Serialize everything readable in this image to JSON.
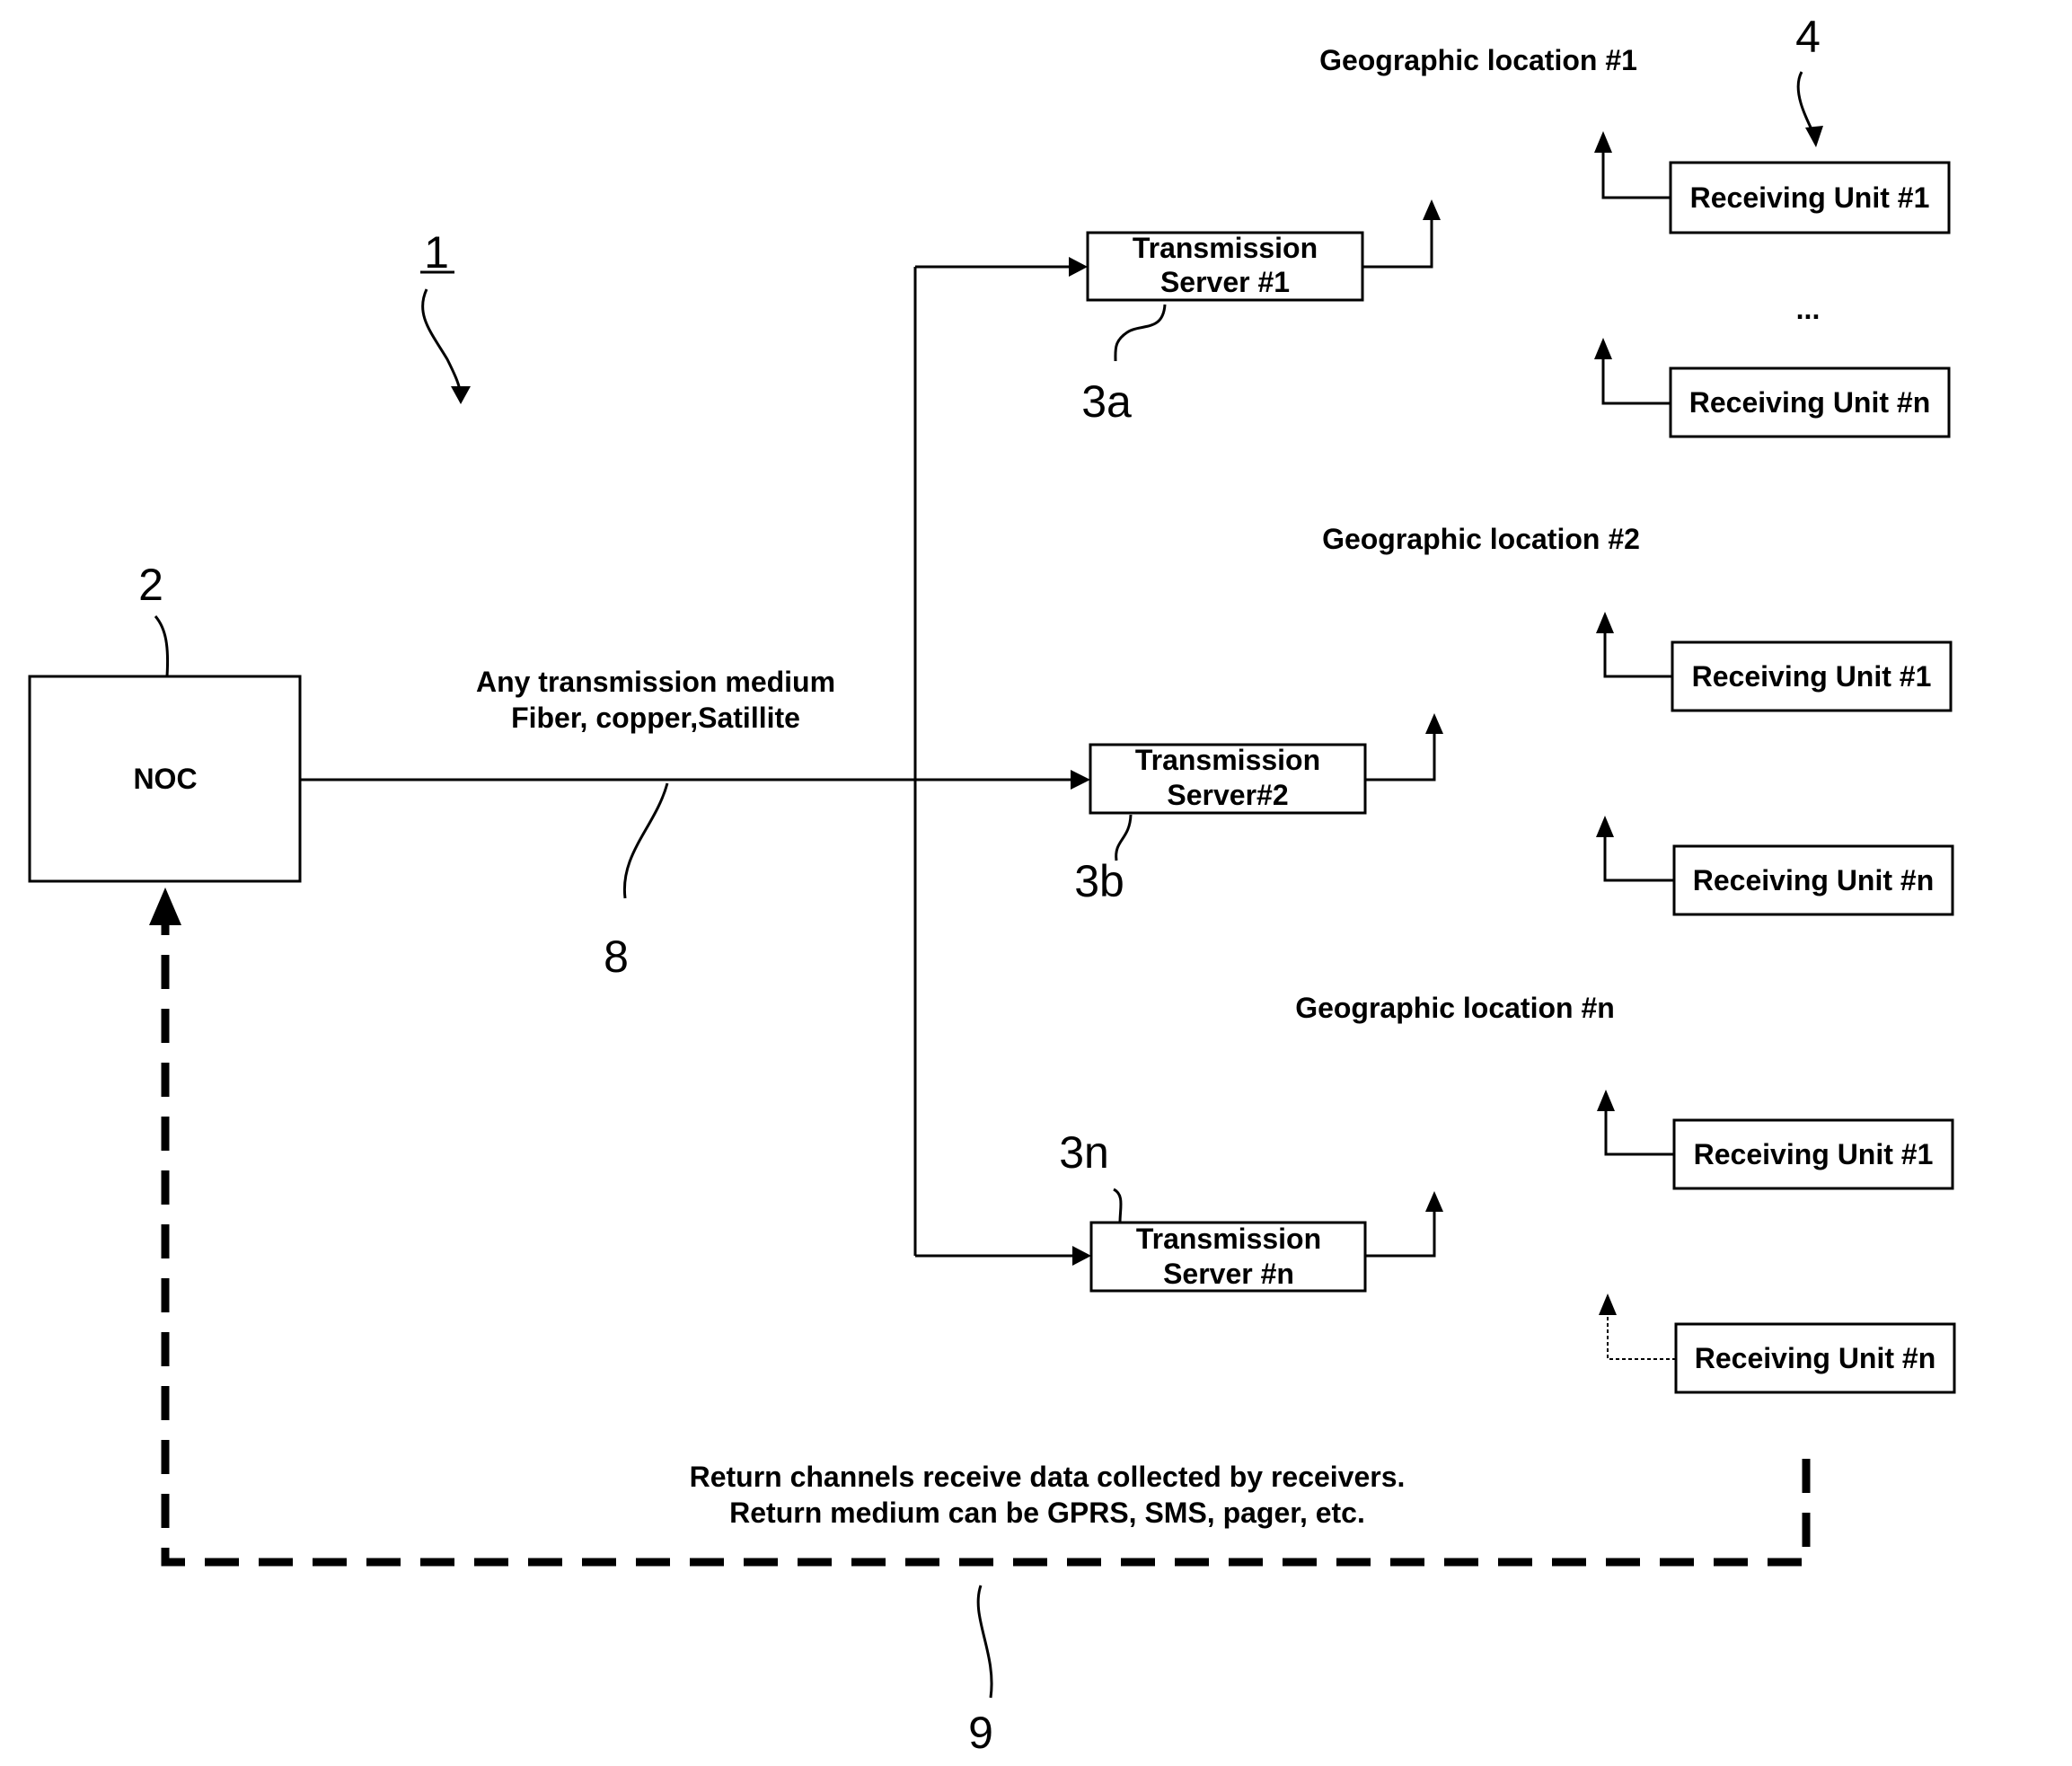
{
  "figure": {
    "system_ref": "1",
    "noc": {
      "ref": "2",
      "label": "NOC"
    },
    "transmission_medium": {
      "ref": "8",
      "line1": "Any transmission medium",
      "line2": "Fiber, copper,Satillite"
    },
    "servers": [
      {
        "ref": "3a",
        "line1": "Transmission",
        "line2": "Server #1"
      },
      {
        "ref": "3b",
        "line1": "Transmission",
        "line2": "Server#2"
      },
      {
        "ref": "3n",
        "line1": "Transmission",
        "line2": "Server #n"
      }
    ],
    "locations": [
      {
        "label": "Geographic location #1",
        "units": [
          "Receiving Unit #1",
          "Receiving Unit #n"
        ]
      },
      {
        "label": "Geographic location #2",
        "units": [
          "Receiving Unit #1",
          "Receiving Unit #n"
        ]
      },
      {
        "label": "Geographic location #n",
        "units": [
          "Receiving Unit #1",
          "Receiving Unit #n"
        ]
      }
    ],
    "receiving_unit_ref": "4",
    "ellipsis": "...",
    "return_channel": {
      "ref": "9",
      "line1": "Return channels receive data collected by receivers.",
      "line2": "Return medium can be GPRS, SMS, pager, etc."
    }
  }
}
